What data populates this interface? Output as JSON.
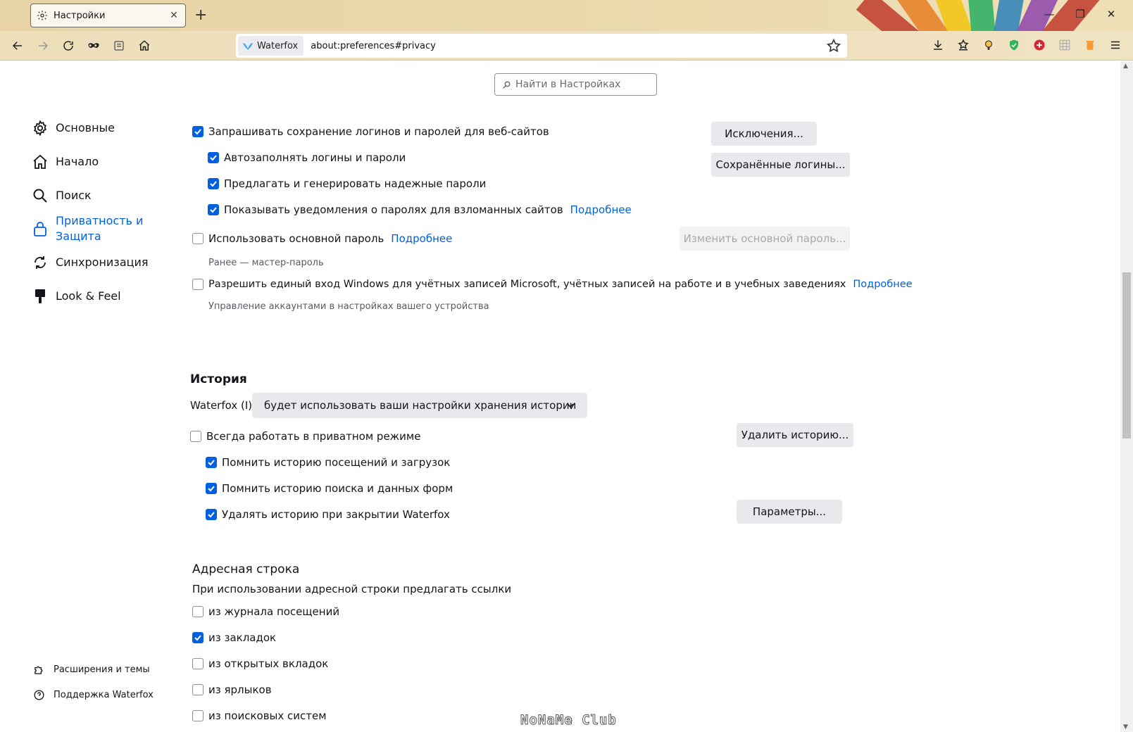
{
  "browser": {
    "tab_title": "Настройки",
    "identity_label": "Waterfox",
    "url": "about:preferences#privacy"
  },
  "search": {
    "placeholder": "Найти в Настройках"
  },
  "sidebar": {
    "items": [
      {
        "label": "Основные",
        "icon": "gear-icon"
      },
      {
        "label": "Начало",
        "icon": "home-icon"
      },
      {
        "label": "Поиск",
        "icon": "search-icon"
      },
      {
        "label_line1": "Приватность и",
        "label_line2": "Защита",
        "icon": "lock-icon",
        "active": true
      },
      {
        "label": "Синхронизация",
        "icon": "sync-icon"
      },
      {
        "label": "Look & Feel",
        "icon": "brush-icon"
      }
    ],
    "footer": [
      {
        "label": "Расширения и темы",
        "icon": "puzzle-icon"
      },
      {
        "label": "Поддержка Waterfox",
        "icon": "help-icon"
      }
    ]
  },
  "logins": {
    "ask_save": {
      "label": "Запрашивать сохранение логинов и паролей для веб-сайтов",
      "checked": true
    },
    "autofill": {
      "label": "Автозаполнять логины и пароли",
      "checked": true
    },
    "suggest": {
      "label": "Предлагать и генерировать надежные пароли",
      "checked": true
    },
    "breach": {
      "label": "Показывать уведомления о паролях для взломанных сайтов",
      "checked": true,
      "link": "Подробнее"
    },
    "primary": {
      "label": "Использовать основной пароль",
      "checked": false,
      "link": "Подробнее",
      "hint": "Ранее — мастер-пароль"
    },
    "windows_sso": {
      "label": "Разрешить единый вход Windows для учётных записей Microsoft, учётных записей на работе и в учебных заведениях",
      "checked": false,
      "link": "Подробнее",
      "hint": "Управление аккаунтами в настройках вашего устройства"
    },
    "exceptions_button": "Исключения...",
    "saved_logins_button": "Сохранённые логины...",
    "change_primary_button": "Изменить основной пароль..."
  },
  "history": {
    "title": "История",
    "select_prefix": "Waterfox (I)",
    "select_value": "будет использовать ваши настройки хранения истории",
    "private_mode": {
      "label": "Всегда работать в приватном режиме",
      "checked": false
    },
    "remember_visits": {
      "label": "Помнить историю посещений и загрузок",
      "checked": true
    },
    "remember_search": {
      "label": "Помнить историю поиска и данных форм",
      "checked": true
    },
    "clear_on_close": {
      "label": "Удалять историю при закрытии Waterfox",
      "checked": true
    },
    "clear_button": "Удалить историю...",
    "settings_button": "Параметры..."
  },
  "address_bar": {
    "title": "Адресная строка",
    "subtitle": "При использовании адресной строки предлагать ссылки",
    "options": [
      {
        "label": "из журнала посещений",
        "checked": false
      },
      {
        "label": "из закладок",
        "checked": true
      },
      {
        "label": "из открытых вкладок",
        "checked": false
      },
      {
        "label": "из ярлыков",
        "checked": false
      },
      {
        "label": "из поисковых систем",
        "checked": false
      }
    ]
  },
  "watermark": "NoNaMe Club",
  "colors": {
    "accent": "#0061e0",
    "button": "#e9e9ed"
  }
}
